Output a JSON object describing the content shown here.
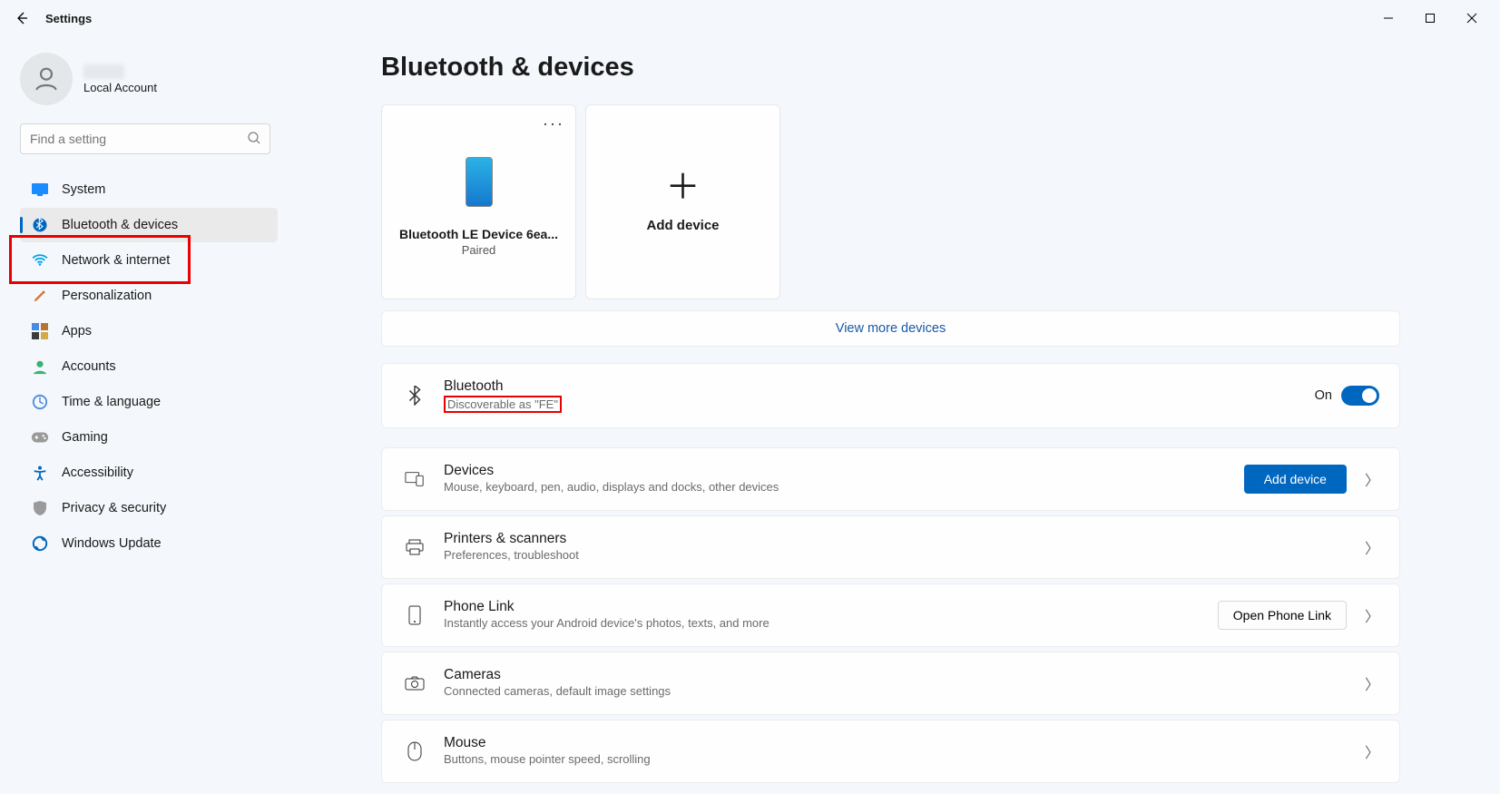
{
  "window": {
    "title": "Settings"
  },
  "user": {
    "account_label": "Local Account"
  },
  "search": {
    "placeholder": "Find a setting"
  },
  "nav": {
    "items": [
      {
        "label": "System"
      },
      {
        "label": "Bluetooth & devices"
      },
      {
        "label": "Network & internet"
      },
      {
        "label": "Personalization"
      },
      {
        "label": "Apps"
      },
      {
        "label": "Accounts"
      },
      {
        "label": "Time & language"
      },
      {
        "label": "Gaming"
      },
      {
        "label": "Accessibility"
      },
      {
        "label": "Privacy & security"
      },
      {
        "label": "Windows Update"
      }
    ]
  },
  "page": {
    "title": "Bluetooth & devices",
    "paired_device": {
      "name": "Bluetooth LE Device 6ea...",
      "status": "Paired"
    },
    "add_device_card": "Add device",
    "view_more": "View more devices",
    "bluetooth": {
      "title": "Bluetooth",
      "subtitle": "Discoverable as \"FE\"",
      "state": "On"
    },
    "devices": {
      "title": "Devices",
      "subtitle": "Mouse, keyboard, pen, audio, displays and docks, other devices",
      "button": "Add device"
    },
    "printers": {
      "title": "Printers & scanners",
      "subtitle": "Preferences, troubleshoot"
    },
    "phone": {
      "title": "Phone Link",
      "subtitle": "Instantly access your Android device's photos, texts, and more",
      "button": "Open Phone Link"
    },
    "cameras": {
      "title": "Cameras",
      "subtitle": "Connected cameras, default image settings"
    },
    "mouse": {
      "title": "Mouse",
      "subtitle": "Buttons, mouse pointer speed, scrolling"
    }
  }
}
